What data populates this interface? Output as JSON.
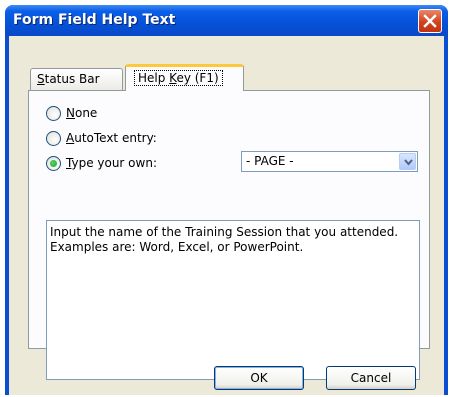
{
  "window": {
    "title": "Form Field Help Text"
  },
  "tabs": [
    {
      "pre": "",
      "mnemonic": "S",
      "post": "tatus Bar",
      "selected": false
    },
    {
      "pre": "Help ",
      "mnemonic": "K",
      "post": "ey (F1)",
      "selected": true
    }
  ],
  "options": [
    {
      "pre": "",
      "mnemonic": "N",
      "post": "one",
      "checked": false
    },
    {
      "pre": "",
      "mnemonic": "A",
      "post": "utoText entry:",
      "checked": false
    },
    {
      "pre": "",
      "mnemonic": "T",
      "post": "ype your own:",
      "checked": true
    }
  ],
  "autotext_select": {
    "value": "- PAGE -"
  },
  "help_text": "Input the name of the Training Session that you attended.  Examples are: Word, Excel, or PowerPoint.",
  "buttons": {
    "ok": "OK",
    "cancel": "Cancel"
  },
  "icons": {
    "close": "close-x-icon",
    "dropdown": "chevron-down-icon"
  },
  "colors": {
    "titlebar": "#0552d8",
    "close_button": "#d2421c",
    "dialog_bg": "#ece9d8",
    "tab_highlight": "#ffc83c",
    "radio_checked": "#21a121"
  }
}
